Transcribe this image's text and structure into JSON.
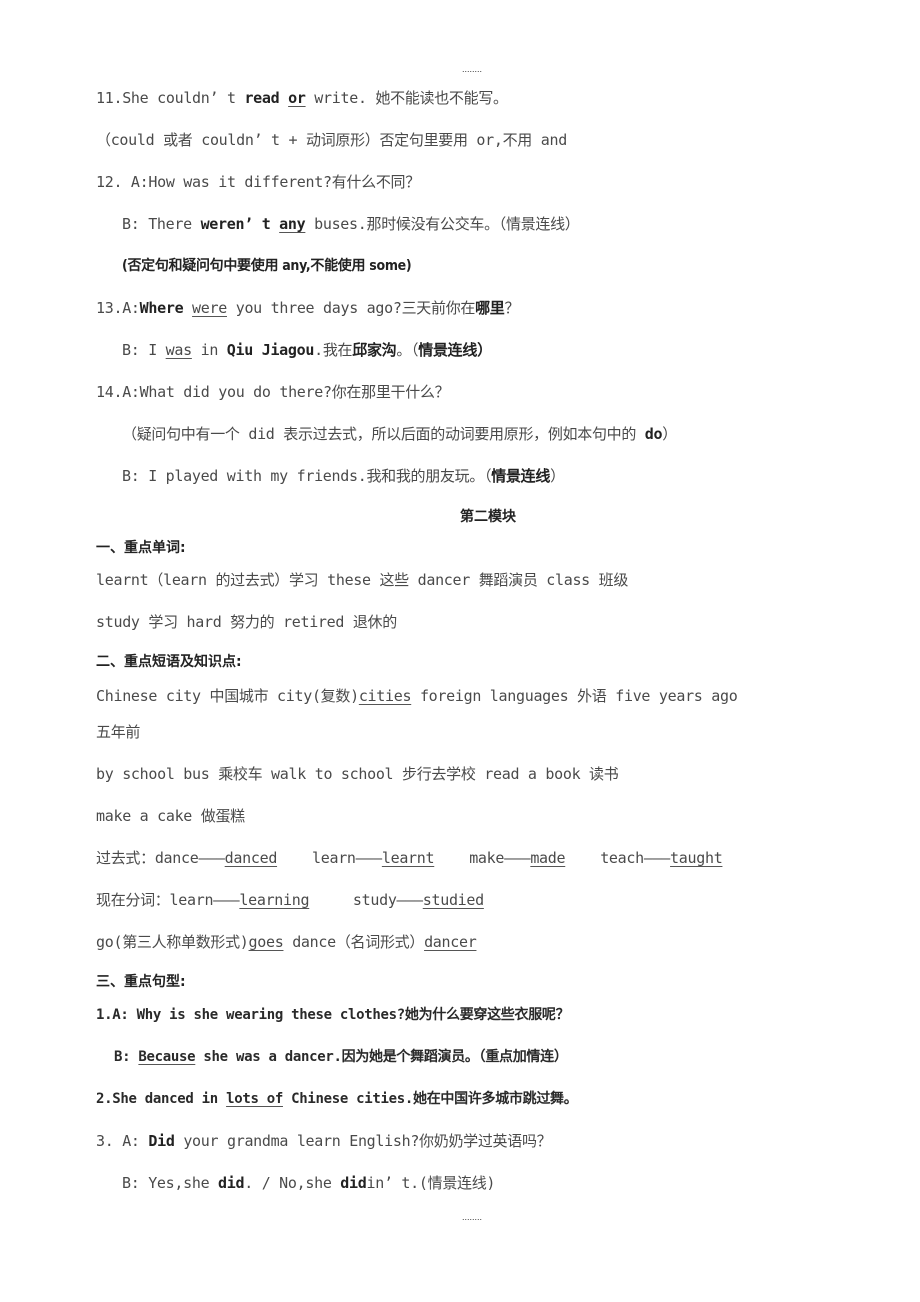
{
  "page_markers": {
    "top": "........",
    "bottom": "........"
  },
  "items": {
    "s11": {
      "num": "11.",
      "p1": "She couldn’ t ",
      "bold1": "read",
      "u1": "or",
      "p2": " write. 她不能读也不能写。",
      "note": "（could 或者 couldn’ t + 动词原形）否定句里要用 or,不用 and"
    },
    "s12": {
      "a": "12.  A:How was it different?有什么不同？",
      "b_pre": "B: There ",
      "b_bold": "weren’ t",
      "b_u": "any",
      "b_post": " buses.那时候没有公交车。（情景连线）",
      "note": "(否定句和疑问句中要使用 any,不能使用 some)"
    },
    "s13": {
      "a_num": "13.A:",
      "a_bold": "Where",
      "a_u": "were",
      "a_mid": " you three days ago?三天前你在",
      "a_bold2": "哪里",
      "a_end": "？",
      "b_pre": "B: I ",
      "b_u": "was",
      "b_mid": " in ",
      "b_bold": "Qiu Jiagou",
      "b_mid2": ".我在",
      "b_bold2": "邱家沟",
      "b_mid3": "。（",
      "b_bold3": "情景连线",
      "b_end": "）"
    },
    "s14": {
      "a": "14.A:What did you do there?你在那里干什么？",
      "note_pre": "（疑问句中有一个 did 表示过去式，所以后面的动词要用原形，例如本句中的 ",
      "note_bold": "do",
      "note_end": "）",
      "b_pre": "B: I played with my friends.我和我的朋友玩。（",
      "b_bold": "情景连线",
      "b_end": "）"
    }
  },
  "module2": {
    "title": "第二模块",
    "section1": {
      "heading": "一、重点单词:",
      "line1": "learnt（learn 的过去式）学习   these 这些   dancer 舞蹈演员   class 班级",
      "line2": "study 学习    hard 努力的    retired 退休的"
    },
    "section2": {
      "heading": "二、重点短语及知识点:",
      "l1_pre": "Chinese city 中国城市   city(复数)",
      "l1_u": "cities",
      "l1_post": "    foreign languages 外语   five years ago",
      "l2": "五年前",
      "l3": "by school bus 乘校车    walk to school 步行去学校   read a book 读书",
      "l4": "make a cake 做蛋糕",
      "past": {
        "label": "过去式：",
        "pairs": [
          {
            "base": "dance———",
            "form": "danced"
          },
          {
            "base": "learn———",
            "form": "learnt"
          },
          {
            "base": "make———",
            "form": "made"
          },
          {
            "base": "teach———",
            "form": "taught"
          }
        ]
      },
      "participle": {
        "label": "现在分词：",
        "pairs": [
          {
            "base": "learn———",
            "form": "learning"
          },
          {
            "base": "study———",
            "form": "studied"
          }
        ]
      },
      "l7_pre": "go(第三人称单数形式)",
      "l7_u1": "goes",
      "l7_mid": "    dance（名词形式）",
      "l7_u2": "dancer"
    },
    "section3": {
      "heading": "三、重点句型:",
      "q1_a": "1.A: Why is she wearing these clothes?她为什么要穿这些衣服呢？",
      "q1_b_pre": "B: ",
      "q1_b_u": "Because",
      "q1_b_post": " she was a dancer.因为她是个舞蹈演员。（重点加情连）",
      "q2_pre": "2.She danced in ",
      "q2_u": "lots of",
      "q2_post": " Chinese cities.她在中国许多城市跳过舞。",
      "q3_a_pre": "3.  A: ",
      "q3_a_bold": "Did",
      "q3_a_post": " your grandma learn English?你奶奶学过英语吗？",
      "q3_b_pre": "B: Yes,she ",
      "q3_b_bold1": "did",
      "q3_b_mid": ". / No,she ",
      "q3_b_bold2": "did",
      "q3_b_end": "in’ t.(情景连线)"
    }
  }
}
